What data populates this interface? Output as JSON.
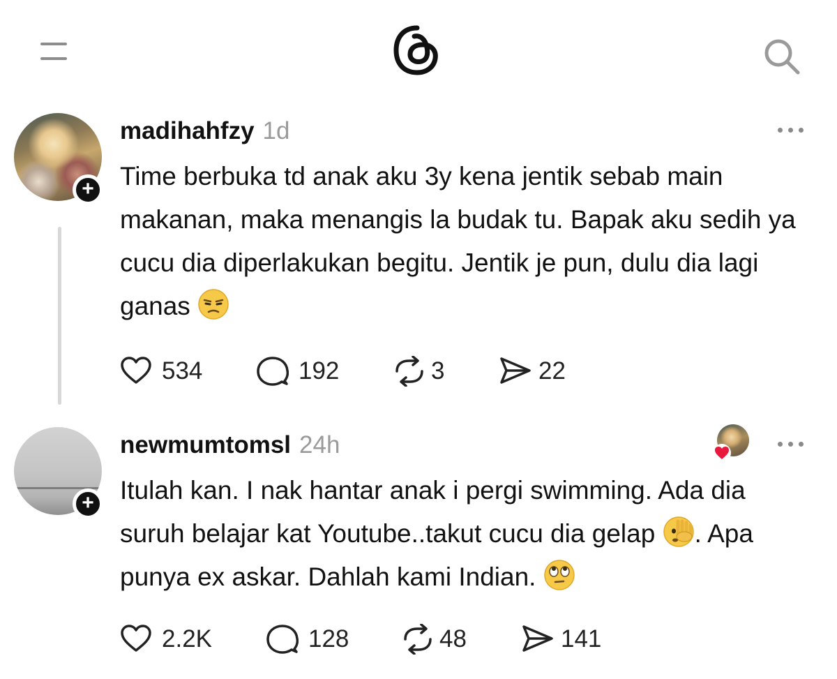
{
  "app": {
    "logo_icon": "threads-logo-icon",
    "menu_icon": "menu-icon",
    "search_icon": "search-icon"
  },
  "posts": [
    {
      "username": "madihahfzy",
      "time": "1d",
      "text_parts": [
        "Time berbuka td anak aku 3y kena jentik sebab main makanan, maka menangis la budak tu. Bapak aku sedih ya cucu dia diperlakukan begitu. Jentik je pun, dulu dia lagi ganas "
      ],
      "emoji": "unamused-face-emoji",
      "likes": "534",
      "replies": "192",
      "reposts": "3",
      "shares": "22"
    },
    {
      "username": "newmumtomsl",
      "time": "24h",
      "text_part_1": "Itulah kan. I nak hantar anak i pergi swimming. Ada dia suruh belajar kat Youtube..takut cucu dia gelap ",
      "text_part_2": ". Apa punya ex askar. Dahlah kami Indian. ",
      "emoji_1": "face-with-peeking-eye-emoji",
      "emoji_2": "rolling-eyes-emoji",
      "liked_by_icon": "liked-by-author-avatar",
      "likes": "2.2K",
      "replies": "128",
      "reposts": "48",
      "shares": "141"
    }
  ],
  "colors": {
    "text": "#111111",
    "muted": "#9a9a9a",
    "icon": "#8c8c8c",
    "heart": "#e8193c"
  }
}
